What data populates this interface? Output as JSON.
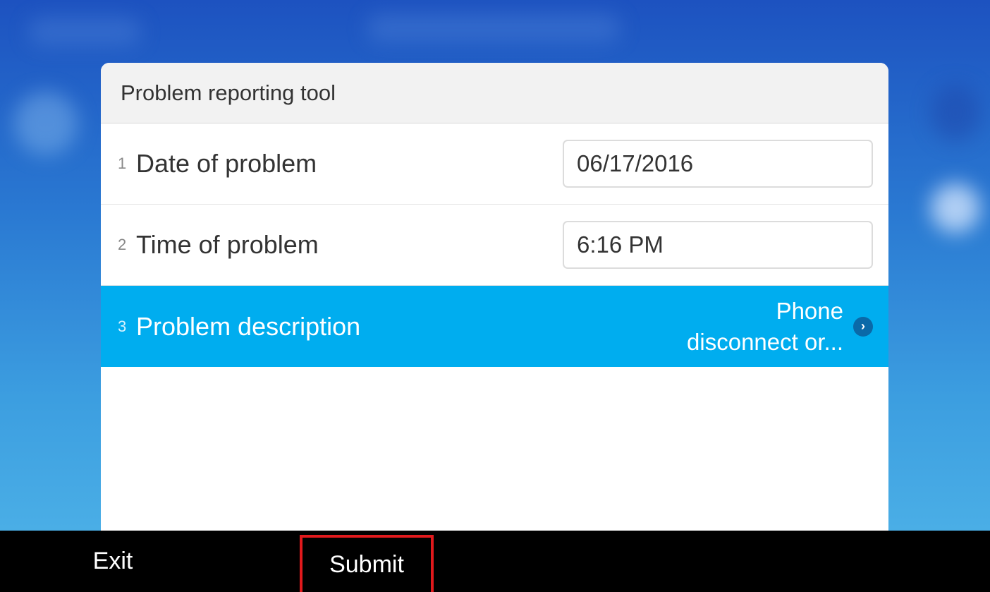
{
  "dialog": {
    "title": "Problem reporting tool",
    "rows": [
      {
        "number": "1",
        "label": "Date of problem",
        "value": "06/17/2016"
      },
      {
        "number": "2",
        "label": "Time of problem",
        "value": "6:16 PM"
      },
      {
        "number": "3",
        "label": "Problem description",
        "value_line1": "Phone",
        "value_line2": "disconnect or..."
      }
    ]
  },
  "icons": {
    "row_chevron": "chevron-right-icon"
  },
  "softkeys": {
    "exit_label": "Exit",
    "submit_label": "Submit"
  },
  "colors": {
    "selected_row": "#00adef",
    "highlight_border": "#e0191c"
  }
}
